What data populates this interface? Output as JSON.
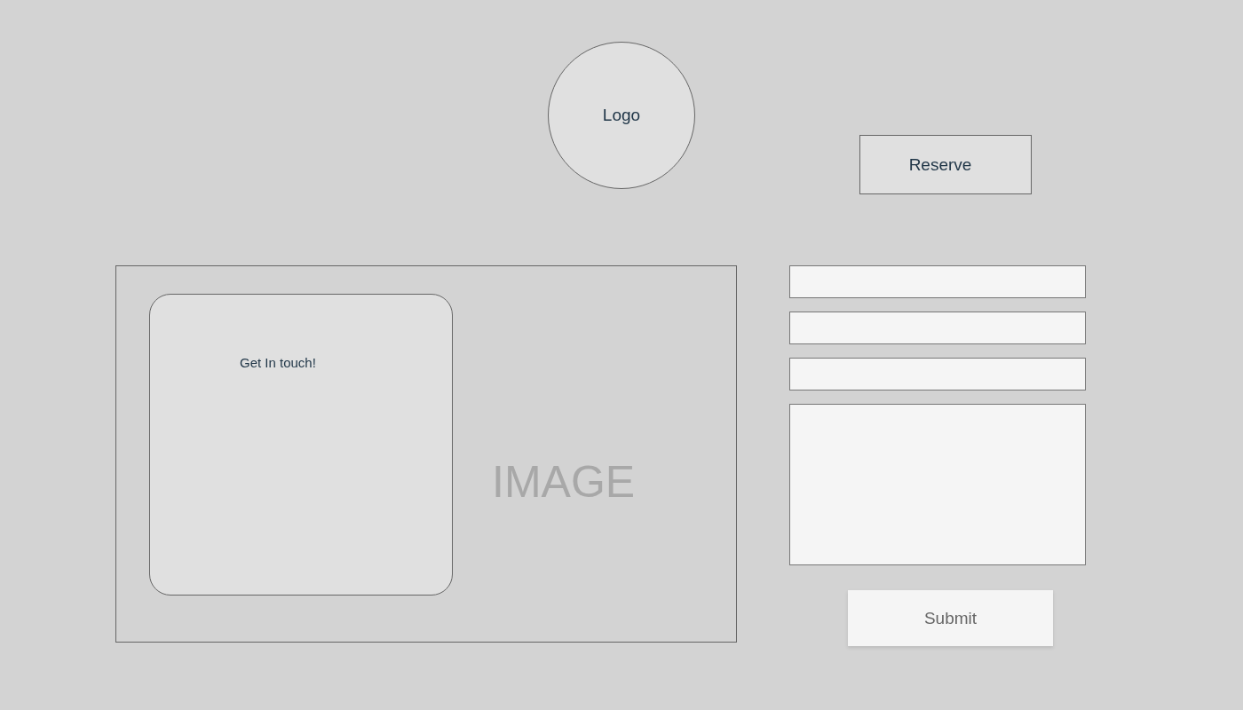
{
  "logo": {
    "label": "Logo"
  },
  "reserve_button": {
    "label": "Reserve"
  },
  "image_panel": {
    "kind": "picture",
    "label": "IMAGE",
    "contact_card": {
      "title": "Get In touch!"
    }
  },
  "form": {
    "fields": [
      {
        "kind": "input"
      },
      {
        "kind": "input"
      },
      {
        "kind": "input"
      },
      {
        "kind": "textarea"
      }
    ],
    "submit": {
      "label": "Submit"
    }
  }
}
